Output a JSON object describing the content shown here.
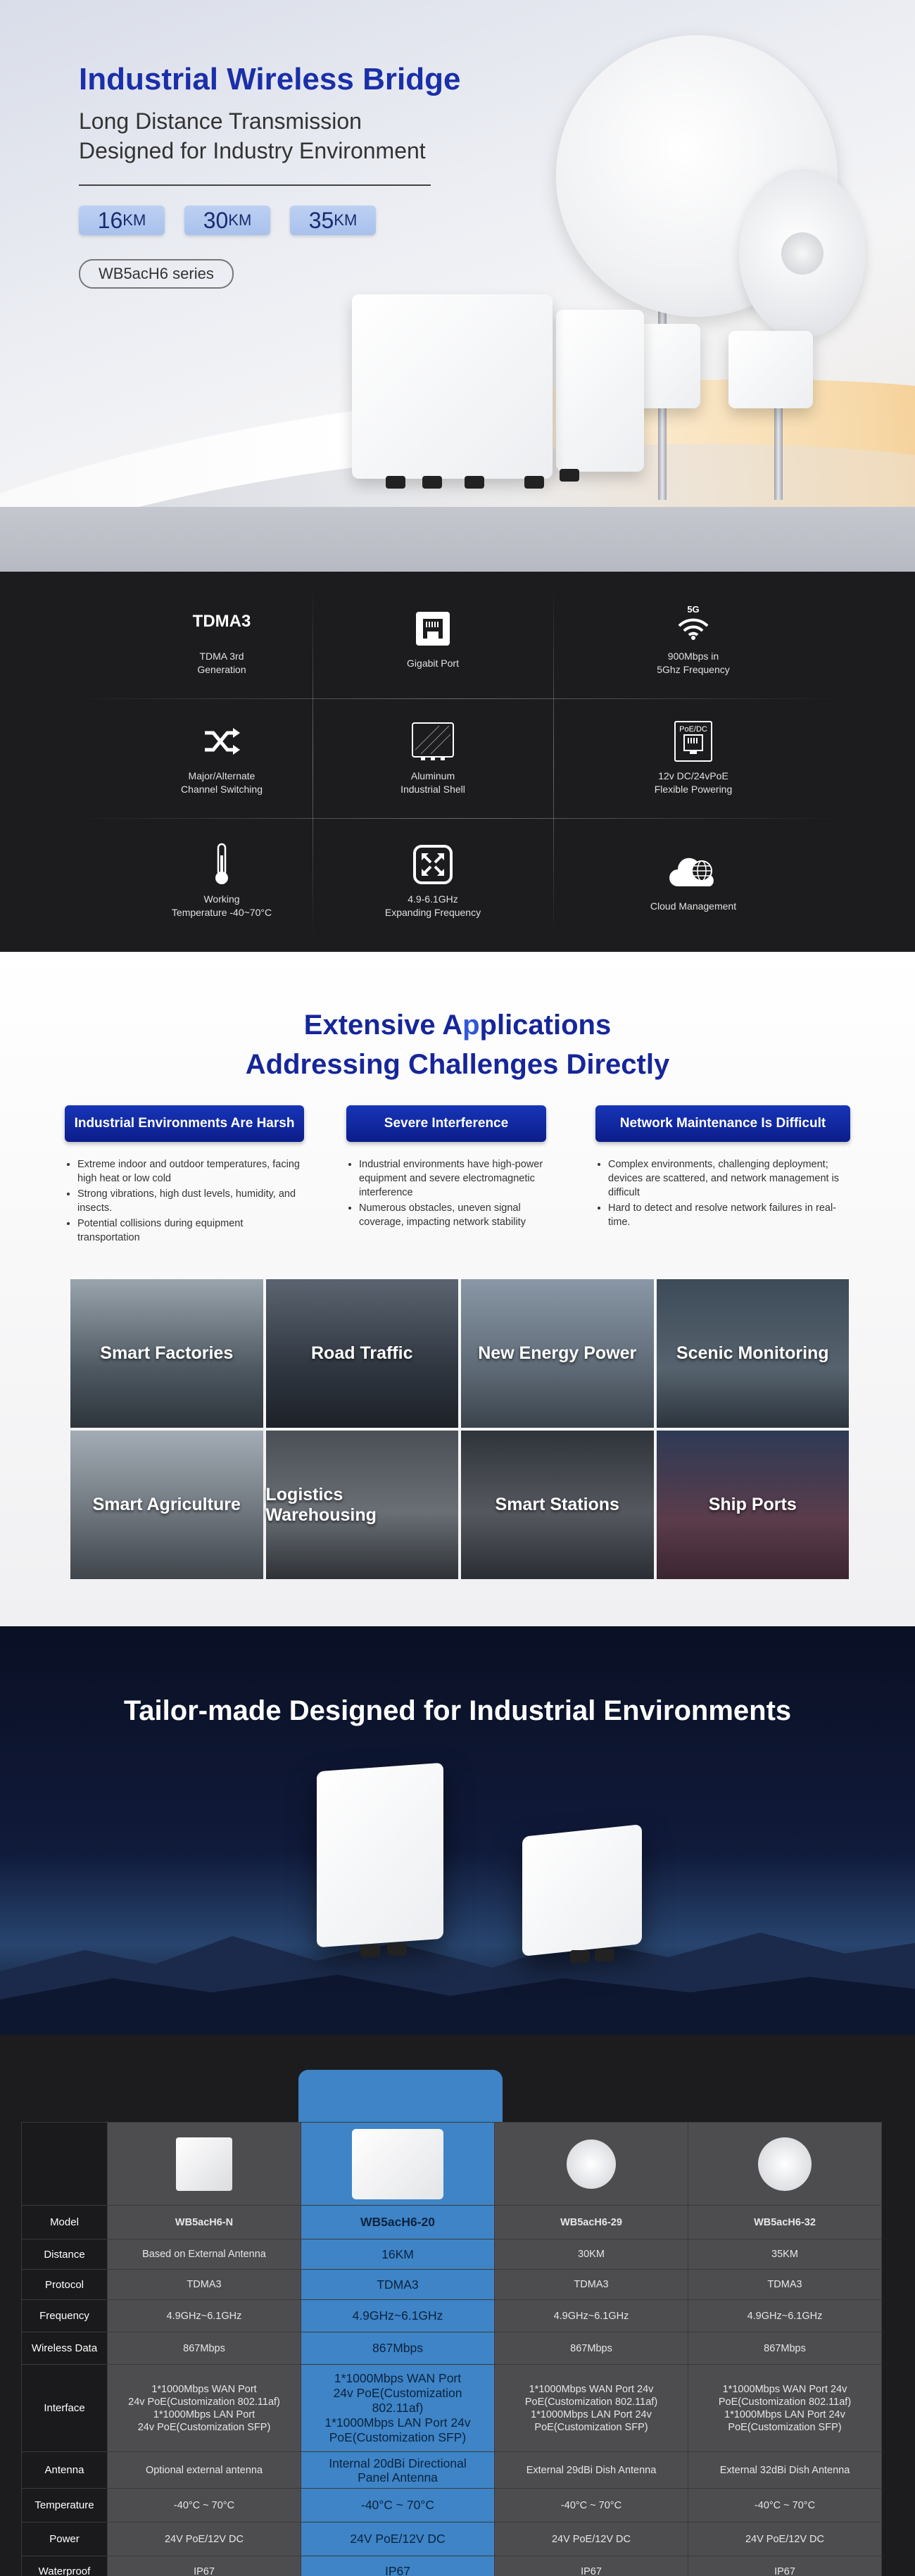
{
  "hero": {
    "title": "Industrial Wireless Bridge",
    "subtitle_line1": "Long Distance Transmission",
    "subtitle_line2": "Designed for Industry Environment",
    "distances": [
      {
        "value": "16",
        "unit": "KM"
      },
      {
        "value": "30",
        "unit": "KM"
      },
      {
        "value": "35",
        "unit": "KM"
      }
    ],
    "series": "WB5acH6 series"
  },
  "features": [
    {
      "icon": "tdma3-text-icon",
      "icon_text": "TDMA3",
      "label": "TDMA 3rd\nGeneration"
    },
    {
      "icon": "ethernet-port-icon",
      "label": "Gigabit Port"
    },
    {
      "icon": "5g-wifi-icon",
      "icon_text": "5G",
      "label": "900Mbps in\n5Ghz Frequency"
    },
    {
      "icon": "shuffle-arrows-icon",
      "label": "Major/Alternate\nChannel Switching"
    },
    {
      "icon": "aluminum-shell-icon",
      "label": "Aluminum\nIndustrial Shell"
    },
    {
      "icon": "poe-dc-icon",
      "icon_text": "PoE/DC",
      "label": "12v DC/24vPoE\nFlexible Powering"
    },
    {
      "icon": "thermometer-icon",
      "label": "Working\nTemperature -40~70°C"
    },
    {
      "icon": "expand-icon",
      "label": "4.9-6.1GHz\nExpanding Frequency"
    },
    {
      "icon": "cloud-globe-icon",
      "label": "Cloud Management"
    }
  ],
  "apps": {
    "title_line1_a": "Extensive A",
    "title_line1_b": "p",
    "title_line1_c": "plications",
    "title_line2": "Addressing Challenges Directly",
    "challenges": [
      {
        "title": "Industrial Environments Are Harsh",
        "items": [
          "Extreme indoor and outdoor temperatures, facing high heat or low cold",
          "Strong vibrations, high dust levels, humidity, and insects.",
          "Potential collisions during equipment transportation"
        ]
      },
      {
        "title": "Severe Interference",
        "items": [
          "Industrial environments have high-power equipment and severe electromagnetic interference",
          "Numerous obstacles, uneven signal coverage, impacting network stability"
        ]
      },
      {
        "title": "Network Maintenance Is Difficult",
        "items": [
          "Complex environments, challenging deployment; devices are scattered, and network management is difficult",
          "Hard to detect and resolve network failures in real-time."
        ]
      }
    ],
    "tiles": [
      "Smart Factories",
      "Road Traffic",
      "New Energy Power",
      "Scenic Monitoring",
      "Smart Agriculture",
      "Logistics Warehousing",
      "Smart Stations",
      "Ship Ports"
    ]
  },
  "tailor": {
    "title": "Tailor-made  Designed for Industrial Environments"
  },
  "specs": {
    "models": [
      "WB5acH6-N",
      "WB5acH6-20",
      "WB5acH6-29",
      "WB5acH6-32"
    ],
    "rows": [
      {
        "label": "Model",
        "values": [
          "WB5acH6-N",
          "WB5acH6-20",
          "WB5acH6-29",
          "WB5acH6-32"
        ]
      },
      {
        "label": "Distance",
        "values": [
          "Based on External Antenna",
          "16KM",
          "30KM",
          "35KM"
        ]
      },
      {
        "label": "Protocol",
        "values": [
          "TDMA3",
          "TDMA3",
          "TDMA3",
          "TDMA3"
        ]
      },
      {
        "label": "Frequency",
        "values": [
          "4.9GHz~6.1GHz",
          "4.9GHz~6.1GHz",
          "4.9GHz~6.1GHz",
          "4.9GHz~6.1GHz"
        ]
      },
      {
        "label": "Wireless Data",
        "values": [
          "867Mbps",
          "867Mbps",
          "867Mbps",
          "867Mbps"
        ]
      },
      {
        "label": "Interface",
        "values": [
          "1*1000Mbps WAN Port\n24v PoE(Customization 802.11af)\n1*1000Mbps LAN Port\n24v PoE(Customization SFP)",
          "1*1000Mbps WAN Port\n24v PoE(Customization\n802.11af)\n1*1000Mbps LAN Port 24v\nPoE(Customization SFP)",
          "1*1000Mbps WAN Port 24v\nPoE(Customization 802.11af)\n1*1000Mbps LAN Port 24v\nPoE(Customization SFP)",
          "1*1000Mbps WAN Port 24v\nPoE(Customization 802.11af)\n1*1000Mbps LAN Port 24v\nPoE(Customization SFP)"
        ]
      },
      {
        "label": "Antenna",
        "values": [
          "Optional external antenna",
          "Internal 20dBi Directional\nPanel Antenna",
          "External 29dBi Dish Antenna",
          "External 32dBi Dish Antenna"
        ]
      },
      {
        "label": "Temperature",
        "values": [
          "-40°C ~ 70°C",
          "-40°C ~ 70°C",
          "-40°C ~ 70°C",
          "-40°C ~ 70°C"
        ]
      },
      {
        "label": "Power",
        "values": [
          "24V PoE/12V DC",
          "24V PoE/12V DC",
          "24V PoE/12V DC",
          "24V PoE/12V DC"
        ]
      },
      {
        "label": "Waterproof",
        "values": [
          "IP67",
          "IP67",
          "IP67",
          "IP67"
        ]
      }
    ]
  }
}
